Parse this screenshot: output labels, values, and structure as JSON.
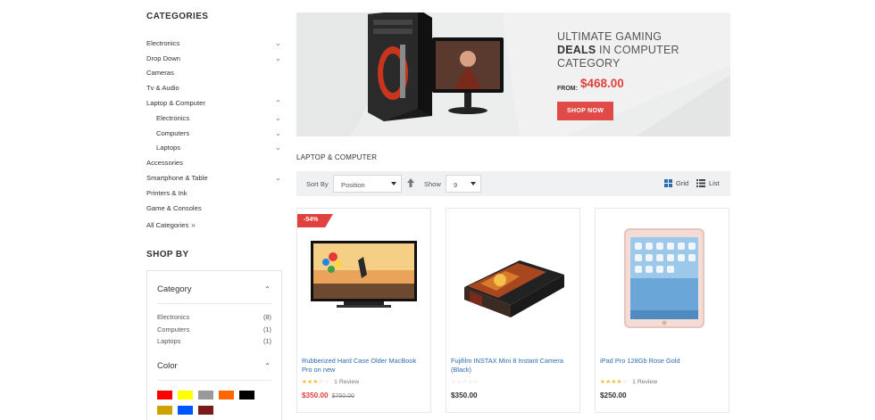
{
  "sidebar": {
    "categories_title": "CATEGORIES",
    "categories": [
      {
        "label": "Electronics",
        "chevron": "chevron-down-icon"
      },
      {
        "label": "Drop Down",
        "chevron": "chevron-down-icon"
      },
      {
        "label": "Cameras",
        "chevron": ""
      },
      {
        "label": "Tv & Audio",
        "chevron": ""
      },
      {
        "label": "Laptop & Computer",
        "chevron": "chevron-up-icon"
      },
      {
        "label": "Electronics",
        "chevron": "chevron-down-icon",
        "sub": true
      },
      {
        "label": "Computers",
        "chevron": "chevron-down-icon",
        "sub": true
      },
      {
        "label": "Laptops",
        "chevron": "chevron-down-icon",
        "sub": true
      },
      {
        "label": "Accessories",
        "chevron": ""
      },
      {
        "label": "Smartphone & Table",
        "chevron": "chevron-down-icon"
      },
      {
        "label": "Printers & Ink",
        "chevron": ""
      },
      {
        "label": "Game & Consoles",
        "chevron": ""
      }
    ],
    "all_categories": "All Categories",
    "shop_by_title": "SHOP BY",
    "filters": {
      "category_title": "Category",
      "category_items": [
        {
          "label": "Electronics",
          "count": "(8)"
        },
        {
          "label": "Computers",
          "count": "(1)"
        },
        {
          "label": "Laptops",
          "count": "(1)"
        }
      ],
      "color_title": "Color",
      "colors": [
        "#ff0000",
        "#ffff00",
        "#999999",
        "#ff6600",
        "#000000",
        "#cca300",
        "#0055ff",
        "#7a1a1a"
      ]
    }
  },
  "banner": {
    "line1": "ULTIMATE GAMING",
    "line2_bold": "DEALS",
    "line2_rest": " IN COMPUTER",
    "line3": "CATEGORY",
    "from_label": "FROM:",
    "price": "$468.00",
    "button": "SHOP NOW",
    "accent": "#e0413f"
  },
  "section_title": "LAPTOP & COMPUTER",
  "toolbar": {
    "sort_label": "Sort By",
    "sort_value": "Position",
    "show_label": "Show",
    "show_value": "9",
    "grid_label": "Grid",
    "list_label": "List"
  },
  "products": [
    {
      "badge": "-54%",
      "name": "Rubberized Hard Case Older MacBook Pro on new",
      "rating": 3,
      "reviews": "1 Review",
      "price": "$350.00",
      "old_price": "$750.00"
    },
    {
      "name": "Fujifilm INSTAX Mini 8 Instant Camera (Black)",
      "rating": 0,
      "reviews": "",
      "price": "$350.00"
    },
    {
      "name": "iPad Pro 128Gb Rose Gold",
      "rating": 4,
      "reviews": "1 Review",
      "price": "$250.00"
    }
  ]
}
